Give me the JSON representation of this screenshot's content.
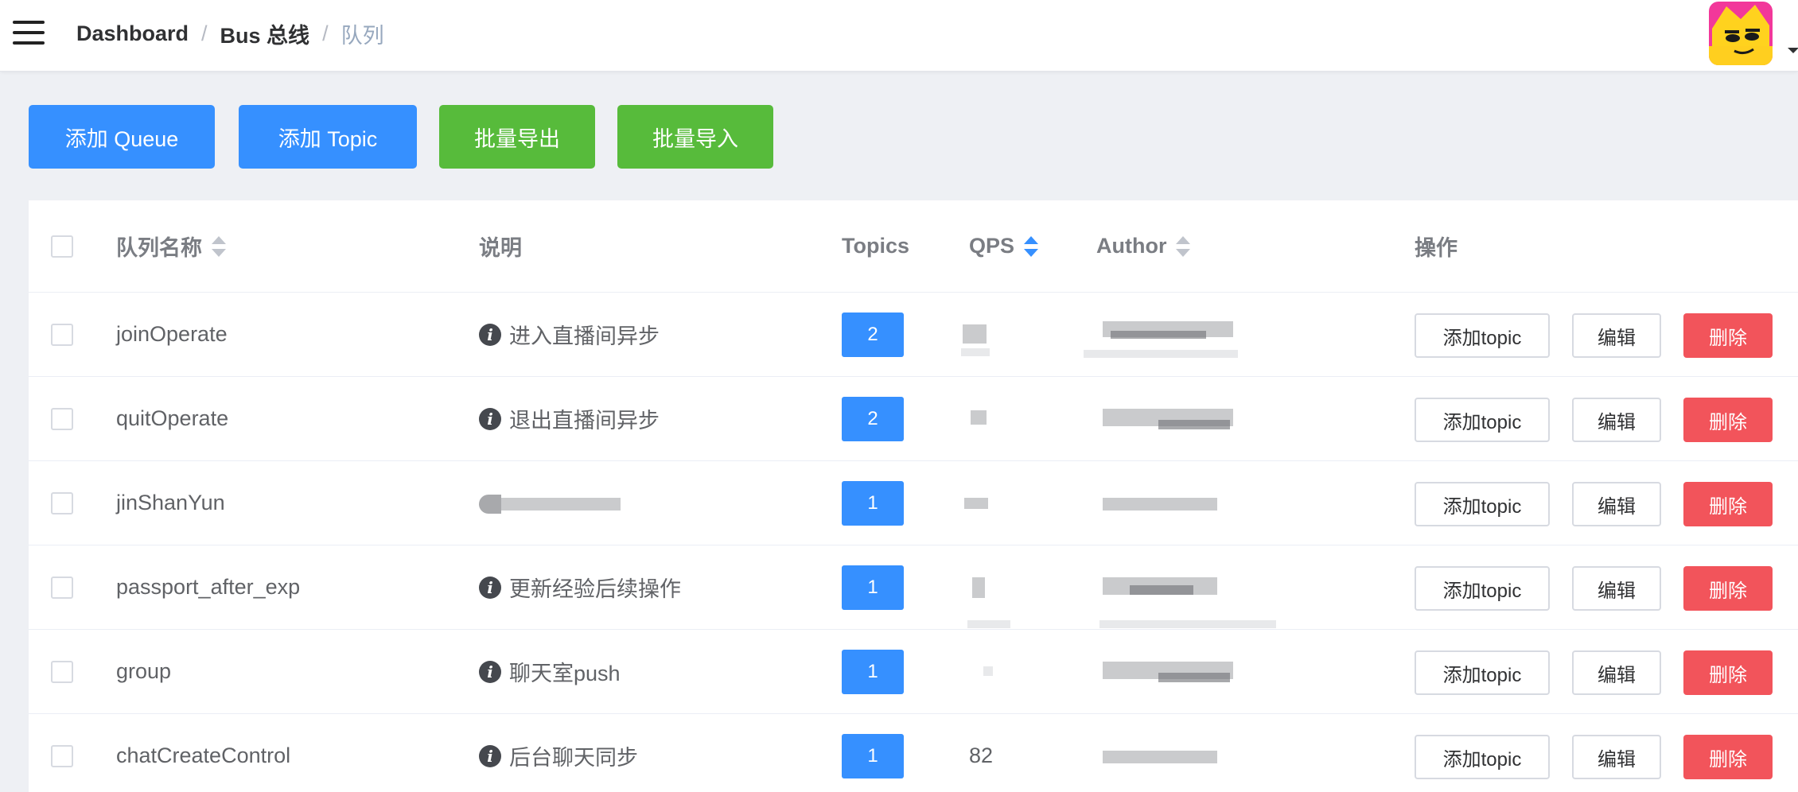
{
  "breadcrumb": {
    "items": [
      "Dashboard",
      "Bus 总线"
    ],
    "separator": "/",
    "current": "队列"
  },
  "toolbar": {
    "add_queue": "添加 Queue",
    "add_topic": "添加 Topic",
    "batch_export": "批量导出",
    "batch_import": "批量导入"
  },
  "table": {
    "headers": {
      "name": "队列名称",
      "desc": "说明",
      "topics": "Topics",
      "qps": "QPS",
      "author": "Author",
      "ops": "操作"
    },
    "rows": [
      {
        "name": "joinOperate",
        "desc": "进入直播间异步",
        "topics": "2",
        "qps": ""
      },
      {
        "name": "quitOperate",
        "desc": "退出直播间异步",
        "topics": "2",
        "qps": ""
      },
      {
        "name": "jinShanYun",
        "desc": "",
        "topics": "1",
        "qps": ""
      },
      {
        "name": "passport_after_exp",
        "desc": "更新经验后续操作",
        "topics": "1",
        "qps": ""
      },
      {
        "name": "group",
        "desc": "聊天室push",
        "topics": "1",
        "qps": ""
      },
      {
        "name": "chatCreateControl",
        "desc": "后台聊天同步",
        "topics": "1",
        "qps": "82"
      }
    ],
    "actions": {
      "add_topic": "添加topic",
      "edit": "编辑",
      "delete": "删除"
    }
  },
  "icons": {
    "menu": "hamburger-icon",
    "info": "info-icon",
    "sort": "sort-caret-icon",
    "avatar": "avatar-image"
  },
  "colors": {
    "primary": "#3690ff",
    "success": "#57bb3b",
    "danger": "#f2545b"
  }
}
